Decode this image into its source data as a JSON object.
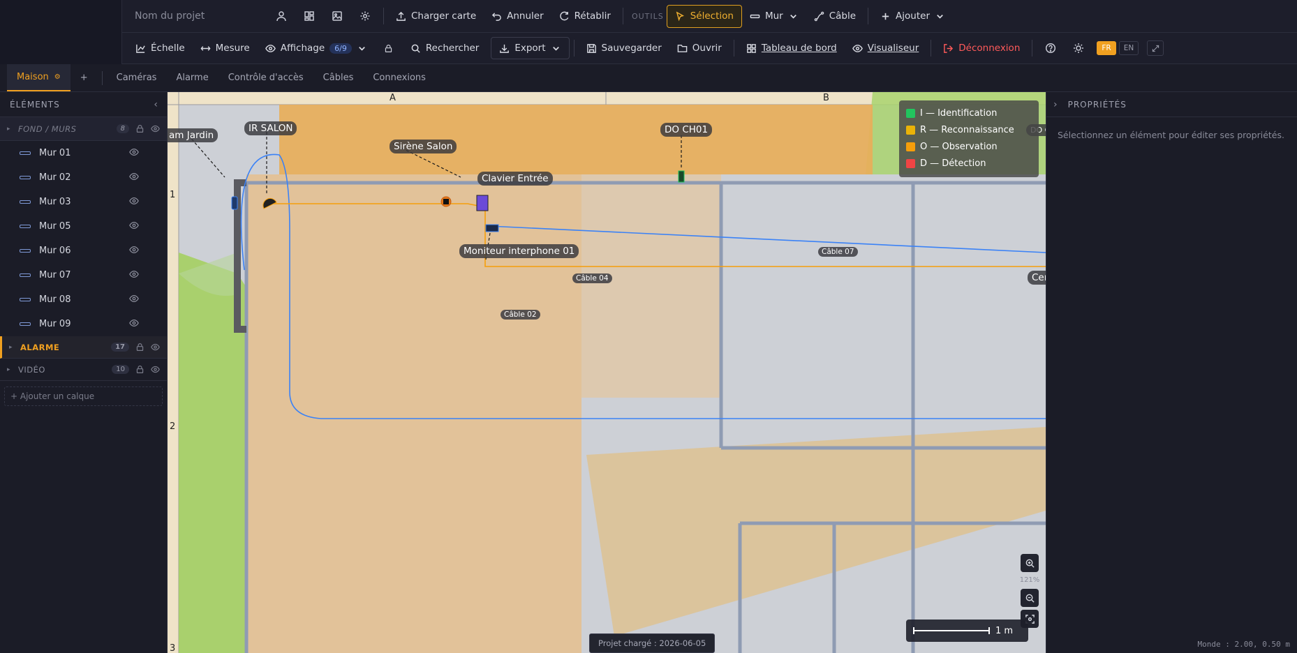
{
  "header": {
    "project_placeholder": "Nom du projet",
    "load_map": "Charger carte",
    "undo": "Annuler",
    "redo": "Rétablir",
    "tools_label": "OUTILS",
    "select": "Sélection",
    "wall": "Mur",
    "cable": "Câble",
    "add": "Ajouter",
    "scale": "Échelle",
    "measure": "Mesure",
    "display": "Affichage",
    "display_badge": "6/9",
    "search": "Rechercher",
    "export": "Export",
    "save": "Sauvegarder",
    "open": "Ouvrir",
    "dashboard": "Tableau de bord",
    "viewer": "Visualiseur",
    "logout": "Déconnexion",
    "lang_fr": "FR",
    "lang_en": "EN"
  },
  "tabs": {
    "active": "Maison",
    "add": "+",
    "items": [
      "Caméras",
      "Alarme",
      "Contrôle d'accès",
      "Câbles",
      "Connexions"
    ]
  },
  "sidebar": {
    "title": "ÉLÉMENTS",
    "groups": [
      {
        "name": "FOND / MURS",
        "count": "8"
      },
      {
        "name": "ALARME",
        "count": "17"
      },
      {
        "name": "VIDÉO",
        "count": "10"
      }
    ],
    "walls": [
      "Mur 01",
      "Mur 02",
      "Mur 03",
      "Mur 05",
      "Mur 06",
      "Mur 07",
      "Mur 08",
      "Mur 09"
    ],
    "add_layer": "+ Ajouter un calque"
  },
  "canvas": {
    "col_a": "A",
    "col_b": "B",
    "row_1": "1",
    "row_2": "2",
    "row_3": "3",
    "labels": {
      "cam_jardin": "am Jardin",
      "ir_salon": "IR SALON",
      "sirene": "Sirène Salon",
      "clavier": "Clavier Entrée",
      "do_ch01": "DO CH01",
      "do_cut": "DO C",
      "moniteur": "Moniteur interphone 01",
      "cen": "Cen"
    },
    "cables": {
      "c07": "Câble 07",
      "c04": "Câble 04",
      "c02": "Câble 02"
    },
    "legend": [
      {
        "label": "I — Identification",
        "color": "#22c55e"
      },
      {
        "label": "R — Reconnaissance",
        "color": "#eab308"
      },
      {
        "label": "O — Observation",
        "color": "#f59e0b"
      },
      {
        "label": "D — Détection",
        "color": "#ef4444"
      }
    ],
    "zoom": "121%",
    "scale_label": "1 m",
    "loaded": "Projet chargé : 2026-06-05"
  },
  "properties": {
    "title": "PROPRIÉTÉS",
    "empty": "Sélectionnez un élément pour éditer ses propriétés.",
    "coords": "Monde : 2.00, 0.50 m"
  }
}
